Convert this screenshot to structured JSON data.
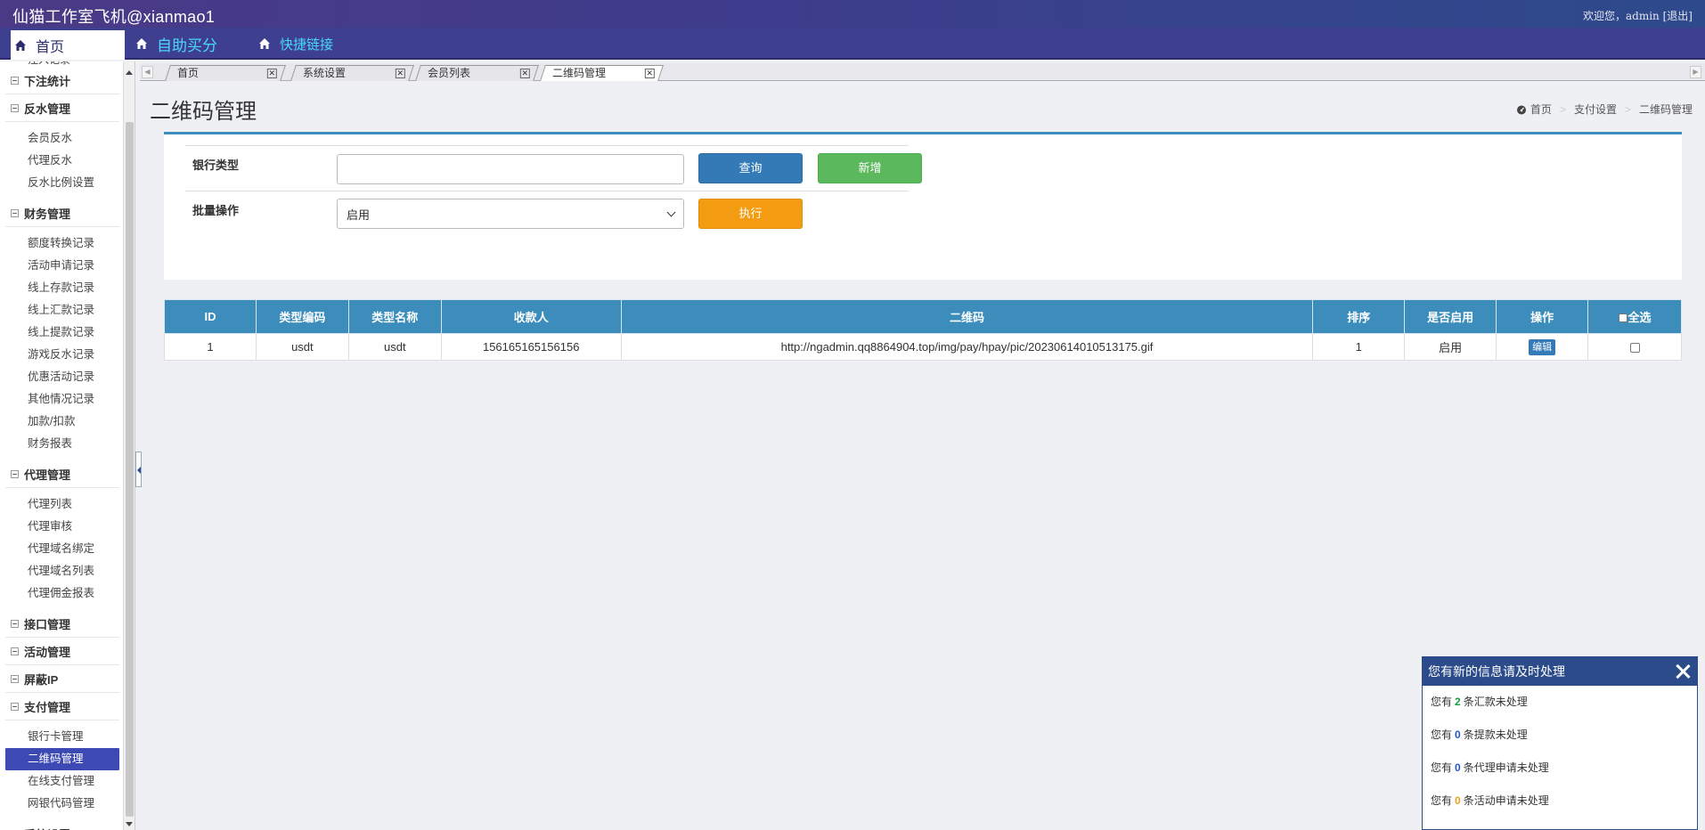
{
  "header": {
    "title": "仙猫工作室飞机@xianmao1",
    "welcome": "欢迎您，admin",
    "logout": "[退出]"
  },
  "nav": {
    "items": [
      {
        "label": "首页"
      },
      {
        "label": "自助买分"
      },
      {
        "label": "快捷链接"
      }
    ]
  },
  "sidebar": {
    "cut_item": "注入记录",
    "groups": [
      {
        "label": "下注统计",
        "items": []
      },
      {
        "label": "反水管理",
        "items": [
          "会员反水",
          "代理反水",
          "反水比例设置"
        ]
      },
      {
        "label": "财务管理",
        "items": [
          "额度转换记录",
          "活动申请记录",
          "线上存款记录",
          "线上汇款记录",
          "线上提款记录",
          "游戏反水记录",
          "优惠活动记录",
          "其他情况记录",
          "加款/扣款",
          "财务报表"
        ]
      },
      {
        "label": "代理管理",
        "items": [
          "代理列表",
          "代理审核",
          "代理域名绑定",
          "代理域名列表",
          "代理佣金报表"
        ]
      },
      {
        "label": "接口管理",
        "items": []
      },
      {
        "label": "活动管理",
        "items": []
      },
      {
        "label": "屏蔽IP",
        "items": []
      },
      {
        "label": "支付管理",
        "items": [
          "银行卡管理",
          "二维码管理",
          "在线支付管理",
          "网银代码管理"
        ]
      },
      {
        "label": "系统设置",
        "items": []
      }
    ],
    "selected": "二维码管理"
  },
  "tabs": [
    {
      "label": "首页"
    },
    {
      "label": "系统设置"
    },
    {
      "label": "会员列表"
    },
    {
      "label": "二维码管理"
    }
  ],
  "tab_close": "✕",
  "page": {
    "title": "二维码管理",
    "breadcrumb": [
      "首页",
      "支付设置",
      "二维码管理"
    ],
    "breadcrumb_sep": ">"
  },
  "filter": {
    "bank_type_label": "银行类型",
    "bank_type_value": "",
    "query_label": "查询",
    "add_label": "新增",
    "batch_label": "批量操作",
    "batch_value": "启用",
    "run_label": "执行"
  },
  "table": {
    "headers": [
      "ID",
      "类型编码",
      "类型名称",
      "收款人",
      "二维码",
      "排序",
      "是否启用",
      "操作",
      "全选"
    ],
    "rows": [
      {
        "id": "1",
        "code": "usdt",
        "name": "usdt",
        "payee": "156165165156156",
        "qrcode": "http://ngadmin.qq8864904.top/img/pay/hpay/pic/20230614010513175.gif",
        "sort": "1",
        "enabled": "启用",
        "action": "编辑"
      }
    ]
  },
  "notice": {
    "title": "您有新的信息请及时处理",
    "lines": [
      {
        "prefix": "您有",
        "num": "2",
        "suffix": "条汇款未处理",
        "color": "#1a9e3c"
      },
      {
        "prefix": "您有",
        "num": "0",
        "suffix": "条提款未处理",
        "color": "#2255cc"
      },
      {
        "prefix": "您有",
        "num": "0",
        "suffix": "条代理申请未处理",
        "color": "#2255cc"
      },
      {
        "prefix": "您有",
        "num": "0",
        "suffix": "条活动申请未处理",
        "color": "#f0a020"
      }
    ]
  },
  "colors": {
    "header_bg": "#3e3c8c",
    "nav_link": "#49d7ff",
    "panel_accent": "#3c8dbc",
    "sidebar_selected": "#3d4ab4",
    "notice_head": "#2b4b8a"
  }
}
